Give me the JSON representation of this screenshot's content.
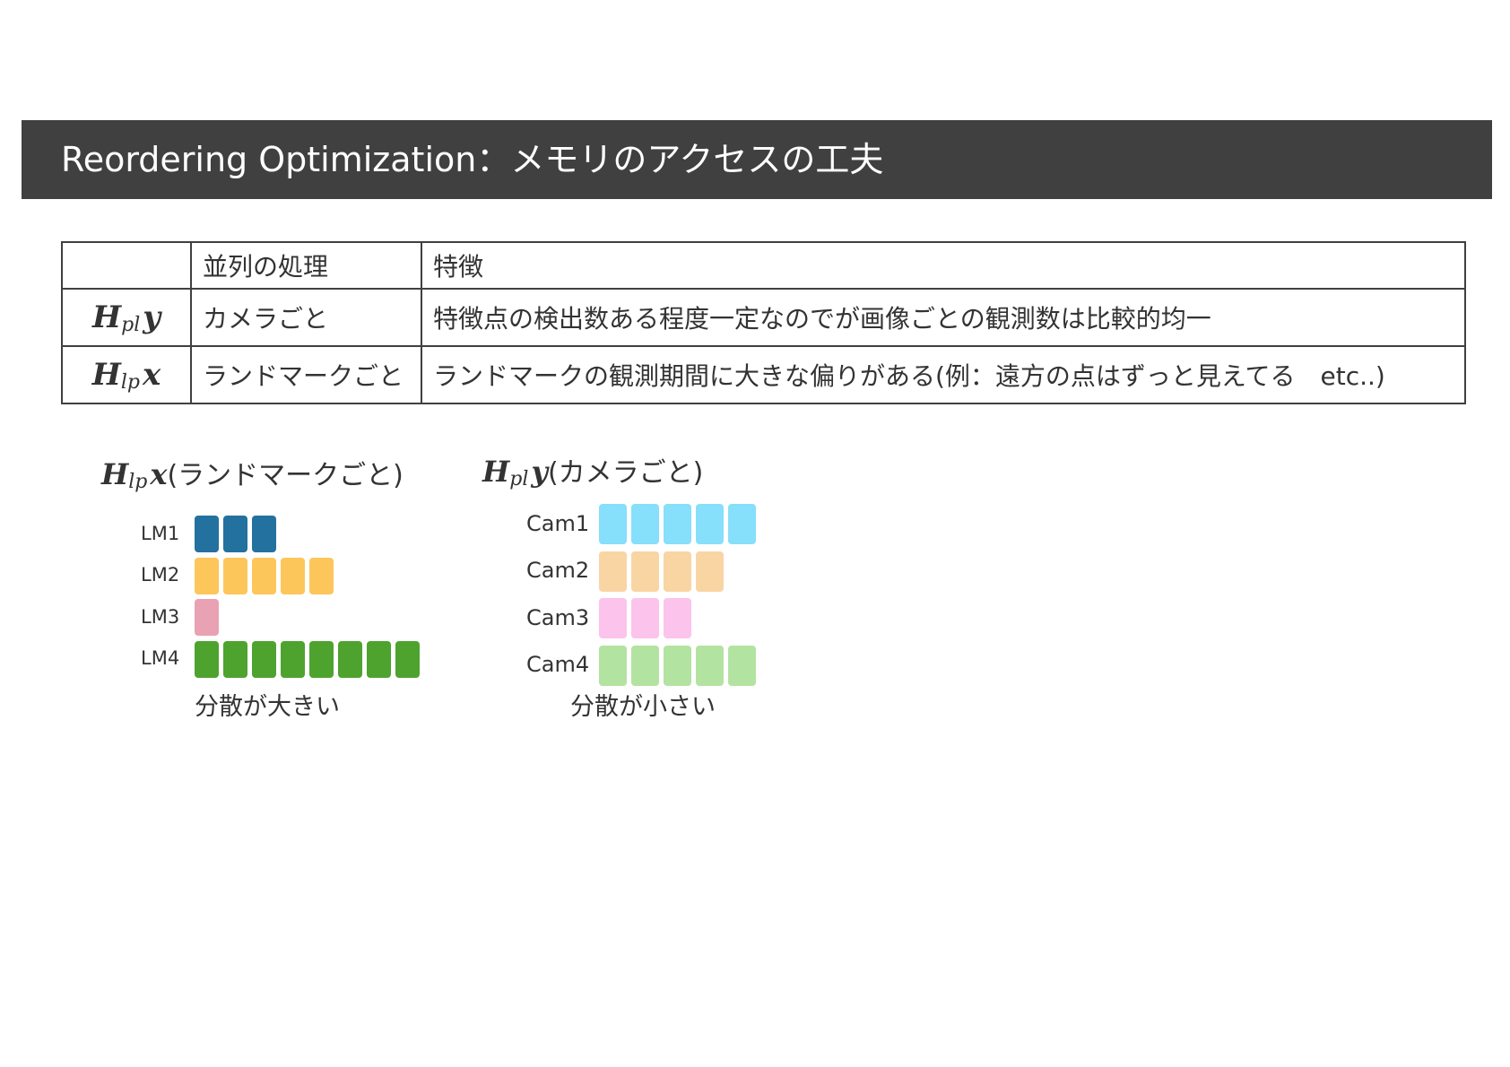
{
  "header": {
    "title": "Reordering Optimization：メモリのアクセスの工夫"
  },
  "table": {
    "col_headers": [
      "",
      "並列の処理",
      "特徴"
    ],
    "rows": [
      {
        "sym_H": "H",
        "sym_sub": "pl",
        "sym_var": "y",
        "process": "カメラごと",
        "feature": "特徴点の検出数ある程度一定なのでが画像ごとの観測数は比較的均一"
      },
      {
        "sym_H": "H",
        "sym_sub": "lp",
        "sym_var": "x",
        "process": "ランドマークごと",
        "feature": "ランドマークの観測期間に大きな偏りがある(例：遠方の点はずっと見えてる　etc..)"
      }
    ]
  },
  "landmark_fig": {
    "sym_H": "H",
    "sym_sub": "lp",
    "sym_var": "x",
    "title_suffix": "(ランドマークごと)",
    "caption": "分散が大きい",
    "rows": [
      {
        "label": "LM1",
        "count": 3,
        "color": "#23719f"
      },
      {
        "label": "LM2",
        "count": 5,
        "color": "#fdc65b"
      },
      {
        "label": "LM3",
        "count": 1,
        "color": "#e9a2b3"
      },
      {
        "label": "LM4",
        "count": 8,
        "color": "#4ea32f"
      }
    ]
  },
  "camera_fig": {
    "sym_H": "H",
    "sym_sub": "pl",
    "sym_var": "y",
    "title_suffix": "(カメラごと)",
    "caption": "分散が小さい",
    "rows": [
      {
        "label": "Cam1",
        "count": 5,
        "color": "#86dffb"
      },
      {
        "label": "Cam2",
        "count": 4,
        "color": "#f9d5a4"
      },
      {
        "label": "Cam3",
        "count": 3,
        "color": "#fcc3ec"
      },
      {
        "label": "Cam4",
        "count": 5,
        "color": "#b3e3a1"
      }
    ]
  }
}
